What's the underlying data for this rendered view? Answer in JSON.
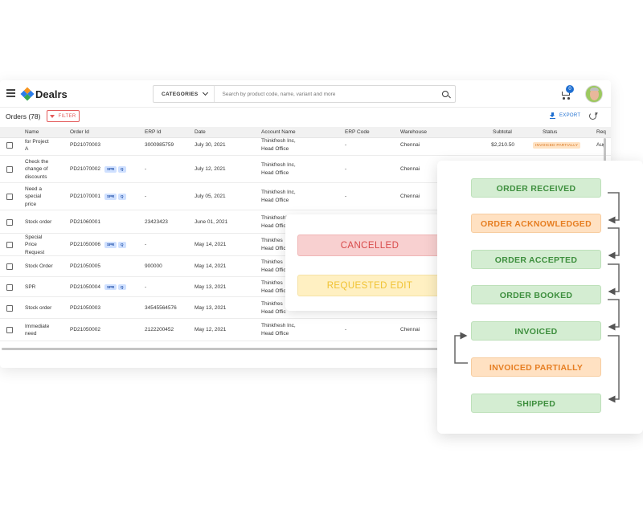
{
  "header": {
    "app_name": "Dealrs",
    "categories_label": "CATEGORIES",
    "search_placeholder": "Search by product code, name, variant and more",
    "cart_count": "0"
  },
  "toolbar": {
    "orders_title": "Orders (78)",
    "filter_label": "FILTER",
    "export_label": "EXPORT"
  },
  "table": {
    "columns": [
      "Name",
      "Order Id",
      "ERP Id",
      "Date",
      "Account Name",
      "ERP Code",
      "Warehouse",
      "Subtotal",
      "Status",
      "Req"
    ],
    "rows": [
      {
        "name": [
          "for Project",
          "A"
        ],
        "order_id": "PD21070003",
        "badges": [],
        "erp_id": "3000985759",
        "date": "July 30, 2021",
        "account": "Thinkfresh Inc,",
        "account_sub": "Head Office",
        "erp_code": "-",
        "warehouse": "Chennai",
        "subtotal": "$2,210.50",
        "status": "INVOICED PARTIALLY",
        "req": "Aug"
      },
      {
        "name": [
          "Check the",
          "change of",
          "discounts"
        ],
        "order_id": "PD21070002",
        "badges": [
          "SPR",
          "Q"
        ],
        "erp_id": "-",
        "date": "July 12, 2021",
        "account": "Thinkfresh Inc,",
        "account_sub": "Head Office",
        "erp_code": "-",
        "warehouse": "Chennai",
        "subtotal": "",
        "status": "",
        "req": ""
      },
      {
        "name": [
          "Need a",
          "special",
          "price"
        ],
        "order_id": "PD21070001",
        "badges": [
          "SPR",
          "Q"
        ],
        "erp_id": "-",
        "date": "July 05, 2021",
        "account": "Thinkfresh Inc,",
        "account_sub": "Head Office",
        "erp_code": "-",
        "warehouse": "Chennai",
        "subtotal": "",
        "status": "",
        "req": ""
      },
      {
        "name": [
          "Stock order"
        ],
        "order_id": "PD21060001",
        "badges": [],
        "erp_id": "23423423",
        "date": "June 01, 2021",
        "account": "Thinkfresh'",
        "account_sub": "Head Offic",
        "erp_code": "",
        "warehouse": "",
        "subtotal": "",
        "status": "",
        "req": ""
      },
      {
        "name": [
          "Special",
          "Price",
          "Request"
        ],
        "order_id": "PD21050006",
        "badges": [
          "SPR",
          "Q"
        ],
        "erp_id": "-",
        "date": "May 14, 2021",
        "account": "Thinkfres",
        "account_sub": "Head Offic",
        "erp_code": "",
        "warehouse": "",
        "subtotal": "",
        "status": "",
        "req": ""
      },
      {
        "name": [
          "Stock Order"
        ],
        "order_id": "PD21050005",
        "badges": [],
        "erp_id": "900000",
        "date": "May 14, 2021",
        "account": "Thinkfres",
        "account_sub": "Head Offic",
        "erp_code": "",
        "warehouse": "",
        "subtotal": "",
        "status": "",
        "req": ""
      },
      {
        "name": [
          "SPR"
        ],
        "order_id": "PD21050004",
        "badges": [
          "SPR",
          "Q"
        ],
        "erp_id": "-",
        "date": "May 13, 2021",
        "account": "Thinkfres",
        "account_sub": "Head Offic",
        "erp_code": "",
        "warehouse": "",
        "subtotal": "",
        "status": "",
        "req": ""
      },
      {
        "name": [
          "Stock order"
        ],
        "order_id": "PD21050003",
        "badges": [],
        "erp_id": "34545564576",
        "date": "May 13, 2021",
        "account": "Thinkfres",
        "account_sub": "Head Offic",
        "erp_code": "",
        "warehouse": "",
        "subtotal": "",
        "status": "",
        "req": ""
      },
      {
        "name": [
          "Immediate",
          "need"
        ],
        "order_id": "PD21050002",
        "badges": [],
        "erp_id": "2122200452",
        "date": "May 12, 2021",
        "account": "Thinkfresh Inc,",
        "account_sub": "Head Office",
        "erp_code": "-",
        "warehouse": "Chennai",
        "subtotal": "",
        "status": "",
        "req": ""
      }
    ]
  },
  "status_card": {
    "cancelled": "CANCELLED",
    "requested_edit": "REQUESTED EDIT"
  },
  "workflow": {
    "steps": [
      {
        "label": "ORDER RECEIVED",
        "tone": "green"
      },
      {
        "label": "ORDER ACKNOWLEDGED",
        "tone": "orange"
      },
      {
        "label": "ORDER ACCEPTED",
        "tone": "green"
      },
      {
        "label": "ORDER BOOKED",
        "tone": "green"
      },
      {
        "label": "INVOICED",
        "tone": "green"
      },
      {
        "label": "INVOICED PARTIALLY",
        "tone": "orange"
      },
      {
        "label": "SHIPPED",
        "tone": "green"
      }
    ]
  },
  "colors": {
    "brand_blue": "#1f6fd1",
    "filter_red": "#e35a5a",
    "step_green": "#3e8f3e",
    "step_orange": "#e67e22"
  }
}
